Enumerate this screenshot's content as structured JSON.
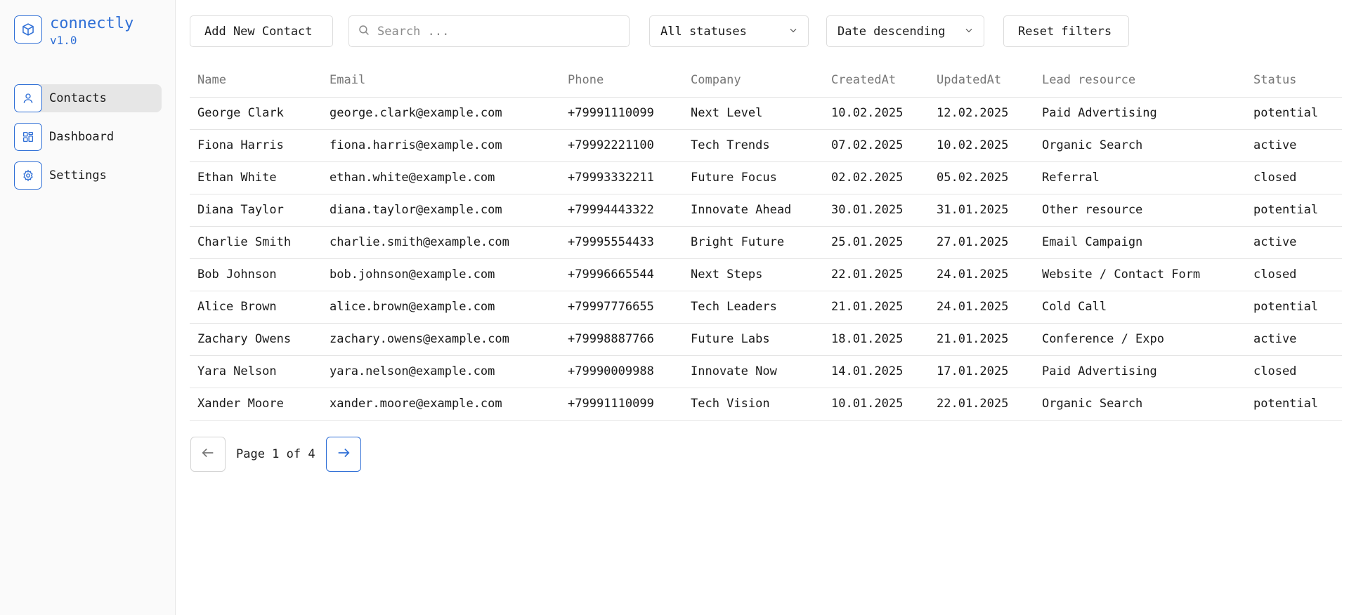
{
  "brand": {
    "name": "connectly",
    "version": "v1.0",
    "icon": "box-icon"
  },
  "nav": [
    {
      "label": "Contacts",
      "icon": "user-icon",
      "active": true
    },
    {
      "label": "Dashboard",
      "icon": "dashboard-icon",
      "active": false
    },
    {
      "label": "Settings",
      "icon": "gear-icon",
      "active": false
    }
  ],
  "toolbar": {
    "add_label": "Add New Contact",
    "search_placeholder": "Search ...",
    "search_value": "",
    "status_filter": "All statuses",
    "sort": "Date descending",
    "reset_label": "Reset filters"
  },
  "table": {
    "columns": [
      "Name",
      "Email",
      "Phone",
      "Company",
      "CreatedAt",
      "UpdatedAt",
      "Lead resource",
      "Status"
    ],
    "rows": [
      [
        "George Clark",
        "george.clark@example.com",
        "+79991110099",
        "Next Level",
        "10.02.2025",
        "12.02.2025",
        "Paid Advertising",
        "potential"
      ],
      [
        "Fiona Harris",
        "fiona.harris@example.com",
        "+79992221100",
        "Tech Trends",
        "07.02.2025",
        "10.02.2025",
        "Organic Search",
        "active"
      ],
      [
        "Ethan White",
        "ethan.white@example.com",
        "+79993332211",
        "Future Focus",
        "02.02.2025",
        "05.02.2025",
        "Referral",
        "closed"
      ],
      [
        "Diana Taylor",
        "diana.taylor@example.com",
        "+79994443322",
        "Innovate Ahead",
        "30.01.2025",
        "31.01.2025",
        "Other resource",
        "potential"
      ],
      [
        "Charlie Smith",
        "charlie.smith@example.com",
        "+79995554433",
        "Bright Future",
        "25.01.2025",
        "27.01.2025",
        "Email Campaign",
        "active"
      ],
      [
        "Bob Johnson",
        "bob.johnson@example.com",
        "+79996665544",
        "Next Steps",
        "22.01.2025",
        "24.01.2025",
        "Website / Contact Form",
        "closed"
      ],
      [
        "Alice Brown",
        "alice.brown@example.com",
        "+79997776655",
        "Tech Leaders",
        "21.01.2025",
        "24.01.2025",
        "Cold Call",
        "potential"
      ],
      [
        "Zachary Owens",
        "zachary.owens@example.com",
        "+79998887766",
        "Future Labs",
        "18.01.2025",
        "21.01.2025",
        "Conference / Expo",
        "active"
      ],
      [
        "Yara Nelson",
        "yara.nelson@example.com",
        "+79990009988",
        "Innovate Now",
        "14.01.2025",
        "17.01.2025",
        "Paid Advertising",
        "closed"
      ],
      [
        "Xander Moore",
        "xander.moore@example.com",
        "+79991110099",
        "Tech Vision",
        "10.01.2025",
        "22.01.2025",
        "Organic Search",
        "potential"
      ]
    ]
  },
  "pagination": {
    "text": "Page 1 of 4",
    "current": 1,
    "total": 4
  },
  "colors": {
    "accent": "#2f6fd6",
    "sidebar_bg": "#fafafa",
    "active_nav_bg": "#e6e6e6",
    "border": "#dcdcdc"
  }
}
